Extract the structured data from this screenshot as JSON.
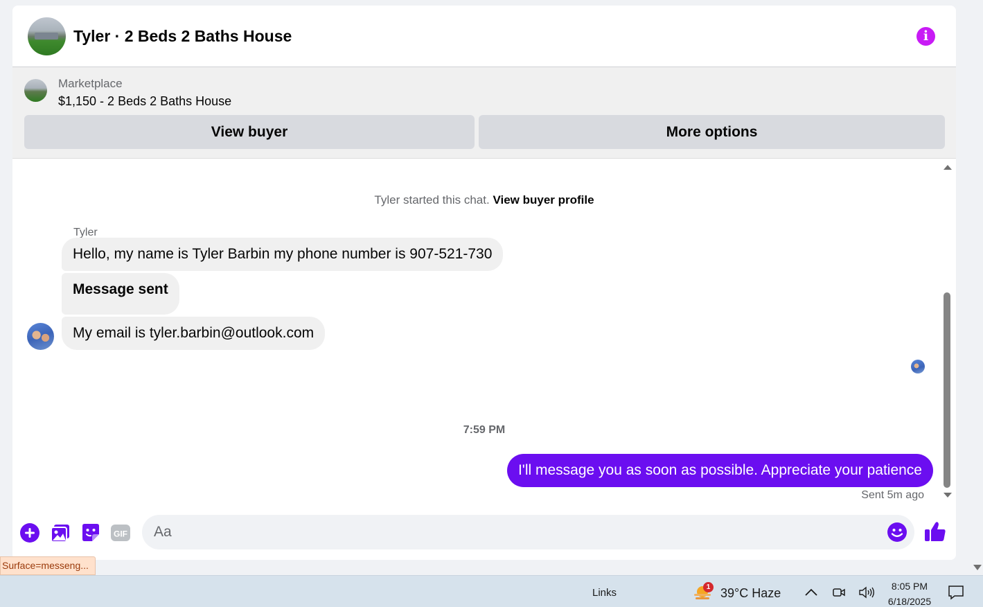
{
  "header": {
    "title": "Tyler · 2 Beds 2 Baths House",
    "info_icon": "info-icon",
    "accent_color": "#c81bf5"
  },
  "listing": {
    "source": "Marketplace",
    "title": "$1,150 - 2 Beds 2 Baths House",
    "view_buyer_label": "View buyer",
    "more_options_label": "More options"
  },
  "conversation": {
    "started_text": "Tyler started this chat.",
    "view_profile_link": "View buyer profile",
    "sender_name": "Tyler",
    "incoming": [
      "Hello, my name is Tyler Barbin my phone number is 907-521-730",
      "Message sent",
      "My email is tyler.barbin@outlook.com"
    ],
    "timestamp": "7:59 PM",
    "outgoing": "I'll message you as soon as possible. Appreciate your patience",
    "outgoing_color": "#6b0ef0",
    "sent_status": "Sent 5m ago"
  },
  "composer": {
    "placeholder": "Aa",
    "tools": [
      "add-icon",
      "photo-icon",
      "sticker-icon",
      "gif-icon"
    ],
    "emoji_icon": "emoji-icon",
    "like_icon": "thumbs-up-icon",
    "gif_label": "GIF"
  },
  "status_tip": "Surface=messeng...",
  "taskbar": {
    "links_label": "Links",
    "weather_badge": "1",
    "weather": "39°C  Haze",
    "time": "8:05 PM",
    "date": "6/18/2025"
  }
}
